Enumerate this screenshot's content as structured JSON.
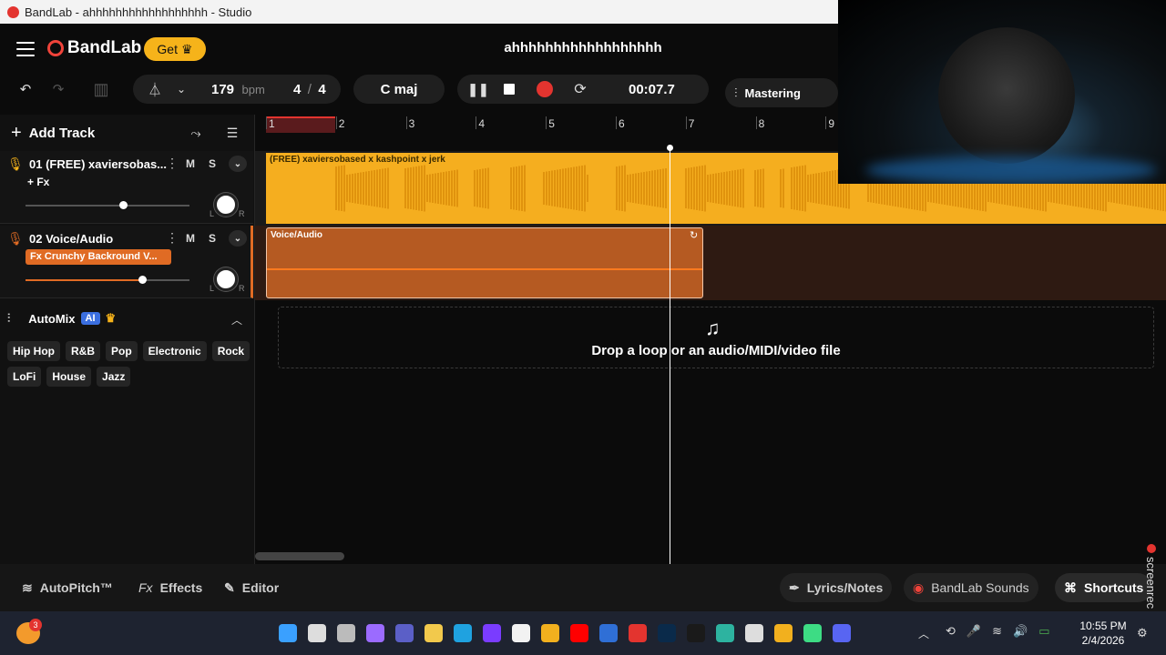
{
  "window": {
    "title": "BandLab - ahhhhhhhhhhhhhhhhhh - Studio"
  },
  "header": {
    "logo_text": "BandLab",
    "get_label": "Get",
    "song_title": "ahhhhhhhhhhhhhhhhhh"
  },
  "transport": {
    "bpm_value": "179",
    "bpm_unit": "bpm",
    "time_sig_top": "4",
    "time_sig_sep": "/",
    "time_sig_bottom": "4",
    "key": "C maj",
    "time": "00:07.7",
    "mastering_label": "Mastering"
  },
  "left_panel": {
    "add_track_label": "Add Track",
    "tracks": [
      {
        "name": "01  (FREE) xaviersobas...",
        "m": "M",
        "s": "S",
        "fx_label": "+ Fx",
        "volume": 0.6,
        "pan_l": "L",
        "pan_r": "R"
      },
      {
        "name": "02  Voice/Audio",
        "m": "M",
        "s": "S",
        "fx_label": "Fx  Crunchy Backround V...",
        "volume": 0.75,
        "pan_l": "L",
        "pan_r": "R"
      }
    ],
    "automix": {
      "label": "AutoMix",
      "ai_badge": "AI",
      "genres": [
        "Hip Hop",
        "R&B",
        "Pop",
        "Electronic",
        "Rock",
        "LoFi",
        "House",
        "Jazz"
      ]
    }
  },
  "timeline": {
    "bars": [
      "1",
      "2",
      "3",
      "4",
      "5",
      "6",
      "7",
      "8",
      "9"
    ],
    "clip1_label": "(FREE) xaviersobased x kashpoint x jerk",
    "clip2_label": "Voice/Audio",
    "drop_text": "Drop a loop or an audio/MIDI/video file"
  },
  "bottom_bar": {
    "autopitch": "AutoPitch™",
    "effects_prefix": "Fx",
    "effects": "Effects",
    "editor": "Editor",
    "lyrics": "Lyrics/Notes",
    "sounds": "BandLab Sounds",
    "shortcuts": "Shortcuts"
  },
  "taskbar": {
    "time": "10:55 PM",
    "date": "2/4/2026",
    "notification_count": "3"
  },
  "overlay": {
    "screenrec_label": "screenrec"
  },
  "colors": {
    "accent": "#f6b31a",
    "track1": "#f5ae1f",
    "track2": "#b55a22",
    "record": "#e3342f"
  }
}
